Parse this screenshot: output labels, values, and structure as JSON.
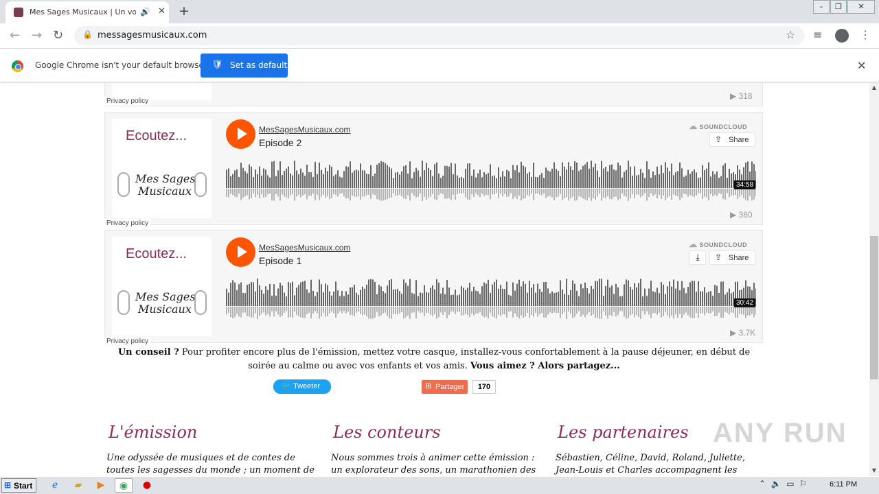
{
  "browser": {
    "tab_title": "Mes Sages Musicaux | Un voyage",
    "url": "messagesmusicaux.com",
    "infobar_text": "Google Chrome isn't your default browser",
    "set_default_label": "Set as default"
  },
  "players": [
    {
      "plays": "318",
      "privacy": "Privacy policy"
    },
    {
      "artwork_text": "Ecoutez...",
      "brand_line1": "Mes Sages",
      "brand_line2": "Musicaux",
      "uploader": "MesSagesMusicaux.com",
      "title": "Episode 2",
      "soundcloud": "SOUNDCLOUD",
      "share": "Share",
      "duration": "34:58",
      "plays": "380",
      "privacy": "Privacy policy"
    },
    {
      "artwork_text": "Ecoutez...",
      "brand_line1": "Mes Sages",
      "brand_line2": "Musicaux",
      "uploader": "MesSagesMusicaux.com",
      "title": "Episode 1",
      "soundcloud": "SOUNDCLOUD",
      "share": "Share",
      "duration": "30:42",
      "plays": "3.7K",
      "privacy": "Privacy policy"
    }
  ],
  "tip": {
    "bold1": "Un conseil ?",
    "text": " Pour profiter encore plus de l'émission, mettez votre casque, installez-vous confortablement à la pause déjeuner, en début de soirée au calme ou avec vos enfants et vos amis. ",
    "bold2": "Vous aimez ? Alors partagez..."
  },
  "social": {
    "tweet": "Tweeter",
    "partager": "Partager",
    "count": "170"
  },
  "columns": [
    {
      "heading": "L'émission",
      "text": "Une odyssée de musiques et de contes de toutes les sagesses du monde ; un moment de sérénité, de"
    },
    {
      "heading": "Les conteurs",
      "text": "Nous sommes trois à animer cette émission : un explorateur des sons, un marathonien des"
    },
    {
      "heading": "Les partenaires",
      "text": "Sébastien, Céline, David, Roland, Juliette, Jean-Louis et Charles accompagnent les conteurs dans"
    }
  ],
  "watermark": "ANY RUN",
  "taskbar": {
    "start": "Start",
    "clock": "6:11 PM"
  },
  "colors": {
    "accent": "#f50",
    "brand": "#8a2c5a",
    "chrome_blue": "#1a73e8",
    "tweet": "#1da1f2"
  }
}
